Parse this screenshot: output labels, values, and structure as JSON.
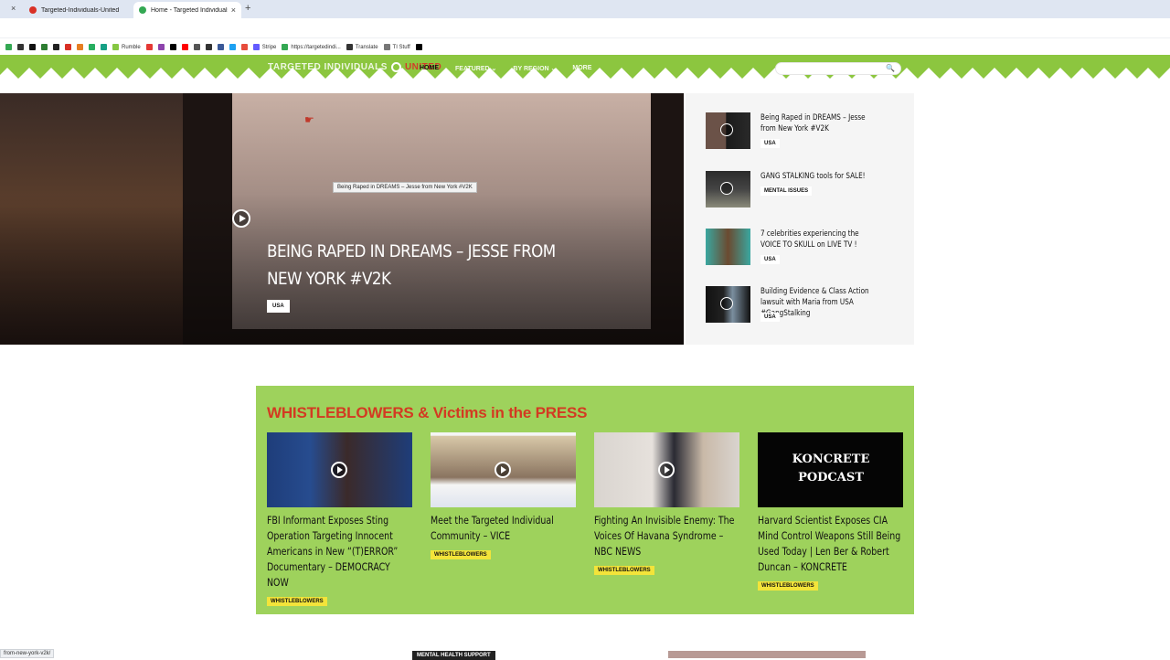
{
  "browser": {
    "tabs": [
      {
        "title": "Targeted-Individuals-United",
        "active": false,
        "favicon_color": "#d93025"
      },
      {
        "title": "Home - Targeted Individuals",
        "active": true,
        "favicon_color": "#34a853"
      }
    ],
    "tab_close": "×",
    "new_tab": "+",
    "bookmarks": [
      {
        "label": "",
        "color": "#34a853"
      },
      {
        "label": "",
        "color": "#333333"
      },
      {
        "label": "",
        "color": "#111111"
      },
      {
        "label": "",
        "color": "#2e7d32"
      },
      {
        "label": "",
        "color": "#222222"
      },
      {
        "label": "",
        "color": "#d93025"
      },
      {
        "label": "",
        "color": "#e67e22"
      },
      {
        "label": "",
        "color": "#27ae60"
      },
      {
        "label": "",
        "color": "#16a085"
      },
      {
        "label": "Rumble",
        "color": "#85c742"
      },
      {
        "label": "",
        "color": "#e53935"
      },
      {
        "label": "",
        "color": "#8e44ad"
      },
      {
        "label": "",
        "color": "#000000"
      },
      {
        "label": "",
        "color": "#ff0000"
      },
      {
        "label": "",
        "color": "#555555"
      },
      {
        "label": "",
        "color": "#333333"
      },
      {
        "label": "",
        "color": "#3b5998"
      },
      {
        "label": "",
        "color": "#1da1f2"
      },
      {
        "label": "",
        "color": "#e74c3c"
      },
      {
        "label": "Stripe",
        "color": "#635bff"
      },
      {
        "label": "https://targetedindi...",
        "color": "#34a853"
      },
      {
        "label": "Translate",
        "color": "#333333"
      },
      {
        "label": "TI Stuff",
        "color": "#777777"
      },
      {
        "label": "",
        "color": "#000000"
      }
    ]
  },
  "header": {
    "logo_prefix": "TARGETED INDIVIDUALS",
    "logo_suffix": "UNITED",
    "nav": [
      {
        "label": "HOME",
        "active": true
      },
      {
        "label": "FEATURED ⌄",
        "active": false
      },
      {
        "label": "BY REGION ⌄",
        "active": false
      },
      {
        "label": "MORE",
        "active": false
      }
    ],
    "search_placeholder": "",
    "search_icon": "🔍",
    "zigzag_color": "#8cc63f"
  },
  "hero": {
    "tooltip": "Being Raped in DREAMS – Jesse from New York #V2K",
    "title": "BEING RAPED IN DREAMS – JESSE FROM NEW YORK #V2K",
    "tag": "USA",
    "cursor": "☛"
  },
  "sidebar": {
    "items": [
      {
        "title": "Being Raped in DREAMS – Jesse from New York #V2K",
        "tag": "USA",
        "thumb_colors": [
          "#6b5248",
          "#1a1a1a"
        ]
      },
      {
        "title": "GANG STALKING tools for SALE!",
        "tag": "MENTAL ISSUES",
        "thumb_colors": [
          "#2b2b2b",
          "#8a8a7a"
        ]
      },
      {
        "title": "7 celebrities experiencing the VOICE TO SKULL on LIVE TV !",
        "tag": "USA",
        "thumb_colors": [
          "#3aa7a0",
          "#6b4a30"
        ]
      },
      {
        "title": "Building Evidence & Class Action lawsuit with Maria from USA #GangStalking",
        "tag": "USA",
        "thumb_colors": [
          "#111111",
          "#7b8fa0"
        ]
      }
    ]
  },
  "press": {
    "title": "WHISTLEBLOWERS & Victims in the PRESS",
    "cards": [
      {
        "title": "FBI Informant Exposes Sting Operation Targeting Innocent Americans in New “(T)ERROR” Documentary – DEMOCRACY NOW",
        "tag": "WHISTLEBLOWERS",
        "thumb_colors": [
          "#1e3d7a",
          "#3b2a2a"
        ]
      },
      {
        "title": "Meet the Targeted Individual Community – VICE",
        "tag": "WHISTLEBLOWERS",
        "thumb_colors": [
          "#d8c8a8",
          "#f5f5f5"
        ]
      },
      {
        "title": "Fighting An Invisible Enemy: The Voices Of Havana Syndrome – NBC NEWS",
        "tag": "WHISTLEBLOWERS",
        "thumb_colors": [
          "#d9d4cf",
          "#2a2a33"
        ]
      },
      {
        "title": "Harvard Scientist Exposes CIA Mind Control Weapons Still Being Used Today | Len Ber & Robert Duncan – KONCRETE",
        "tag": "WHISTLEBLOWERS",
        "thumb_colors": [
          "#050505",
          "#1a1a1a"
        ]
      }
    ],
    "thumb_text_4": "KONCRETE PODCAST"
  },
  "bottom": {
    "status_url": "from-new-york-v2k/",
    "tag": "MENTAL HEALTH SUPPORT"
  }
}
